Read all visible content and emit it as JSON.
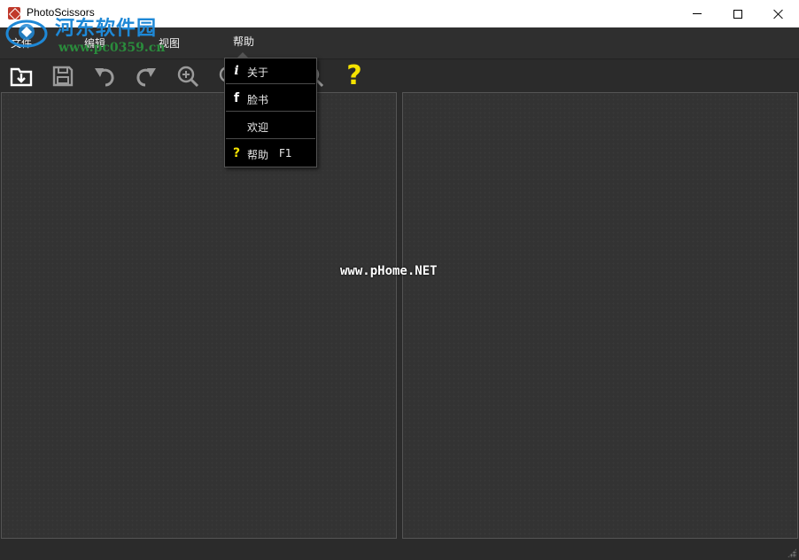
{
  "window": {
    "title": "PhotoScissors"
  },
  "watermark": {
    "title": "河东软件园",
    "url": "www.pc0359.cn",
    "center": "www.pHome.NET"
  },
  "menubar": {
    "items": [
      {
        "label": "文件"
      },
      {
        "label": "编辑"
      },
      {
        "label": "视图"
      },
      {
        "label": "帮助"
      }
    ]
  },
  "toolbar": {
    "help_glyph": "?",
    "icons": [
      "open-icon",
      "save-icon",
      "undo-icon",
      "redo-icon",
      "zoom-in-icon",
      "zoom-out-icon",
      "zoom-fit-icon",
      "help-icon"
    ]
  },
  "help_menu": {
    "items": [
      {
        "icon": "info-icon",
        "glyph": "i",
        "label": "关于",
        "shortcut": ""
      },
      {
        "icon": "facebook-icon",
        "glyph": "f",
        "label": "脸书",
        "shortcut": ""
      },
      {
        "icon": "",
        "glyph": "",
        "label": "欢迎",
        "shortcut": ""
      },
      {
        "icon": "question-icon",
        "glyph": "?",
        "label": "帮助",
        "shortcut": "F1"
      }
    ]
  },
  "colors": {
    "background": "#2b2b2b",
    "panel": "#333333",
    "accent_yellow": "#f5e300",
    "watermark_blue": "#1e88d6",
    "watermark_green": "#2a8c3c"
  }
}
